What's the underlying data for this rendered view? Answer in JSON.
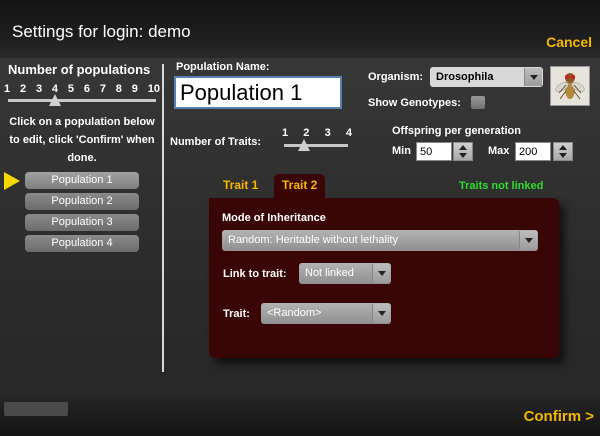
{
  "header": {
    "title": "Settings for login: demo",
    "cancel_label": "Cancel"
  },
  "populations": {
    "title": "Number of populations",
    "slider_ticks": [
      "1",
      "2",
      "3",
      "4",
      "5",
      "6",
      "7",
      "8",
      "9",
      "10"
    ],
    "selected_count": 4,
    "instructions": "Click on a population below to edit, click 'Confirm' when done.",
    "items": [
      "Population 1",
      "Population 2",
      "Population 3",
      "Population 4"
    ],
    "selected_index": 0
  },
  "population_form": {
    "name_label": "Population Name:",
    "name_value": "Population 1",
    "organism_label": "Organism:",
    "organism_value": "Drosophila",
    "show_genotypes_label": "Show Genotypes:",
    "num_traits_label": "Number of Traits:",
    "trait_ticks": [
      "1",
      "2",
      "3",
      "4"
    ],
    "selected_traits": 2,
    "offspring_label": "Offspring per generation",
    "min_label": "Min",
    "min_value": "50",
    "max_label": "Max",
    "max_value": "200"
  },
  "tabs": [
    {
      "label": "Trait 1"
    },
    {
      "label": "Trait 2"
    }
  ],
  "active_tab": 1,
  "traits_status": "Traits not linked",
  "trait_panel": {
    "moi_label": "Mode of Inheritance",
    "moi_value": "Random: Heritable without lethality",
    "link_label": "Link to trait:",
    "link_value": "Not linked",
    "trait_label": "Trait:",
    "trait_value": "<Random>"
  },
  "footer": {
    "confirm_label": "Confirm >"
  },
  "colors": {
    "accent": "#f5b800",
    "panel": "#3a0505",
    "status_green": "#2fdc2f"
  }
}
